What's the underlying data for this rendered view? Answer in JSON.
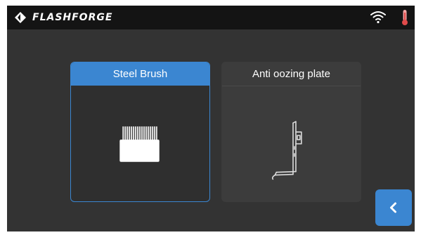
{
  "header": {
    "brand": "FLASHFORGE",
    "icons": {
      "logo": "flashforge-logo-icon",
      "wifi": "wifi-icon",
      "temperature": "thermometer-icon"
    }
  },
  "options": [
    {
      "label": "Steel Brush",
      "selected": true,
      "icon": "steel-brush-icon"
    },
    {
      "label": "Anti oozing plate",
      "selected": false,
      "icon": "anti-oozing-plate-icon"
    }
  ],
  "back_button": {
    "icon": "chevron-left-icon"
  },
  "colors": {
    "accent": "#3b86d1",
    "background": "#333333",
    "topbar": "#141414",
    "alert": "#e04a4a"
  }
}
